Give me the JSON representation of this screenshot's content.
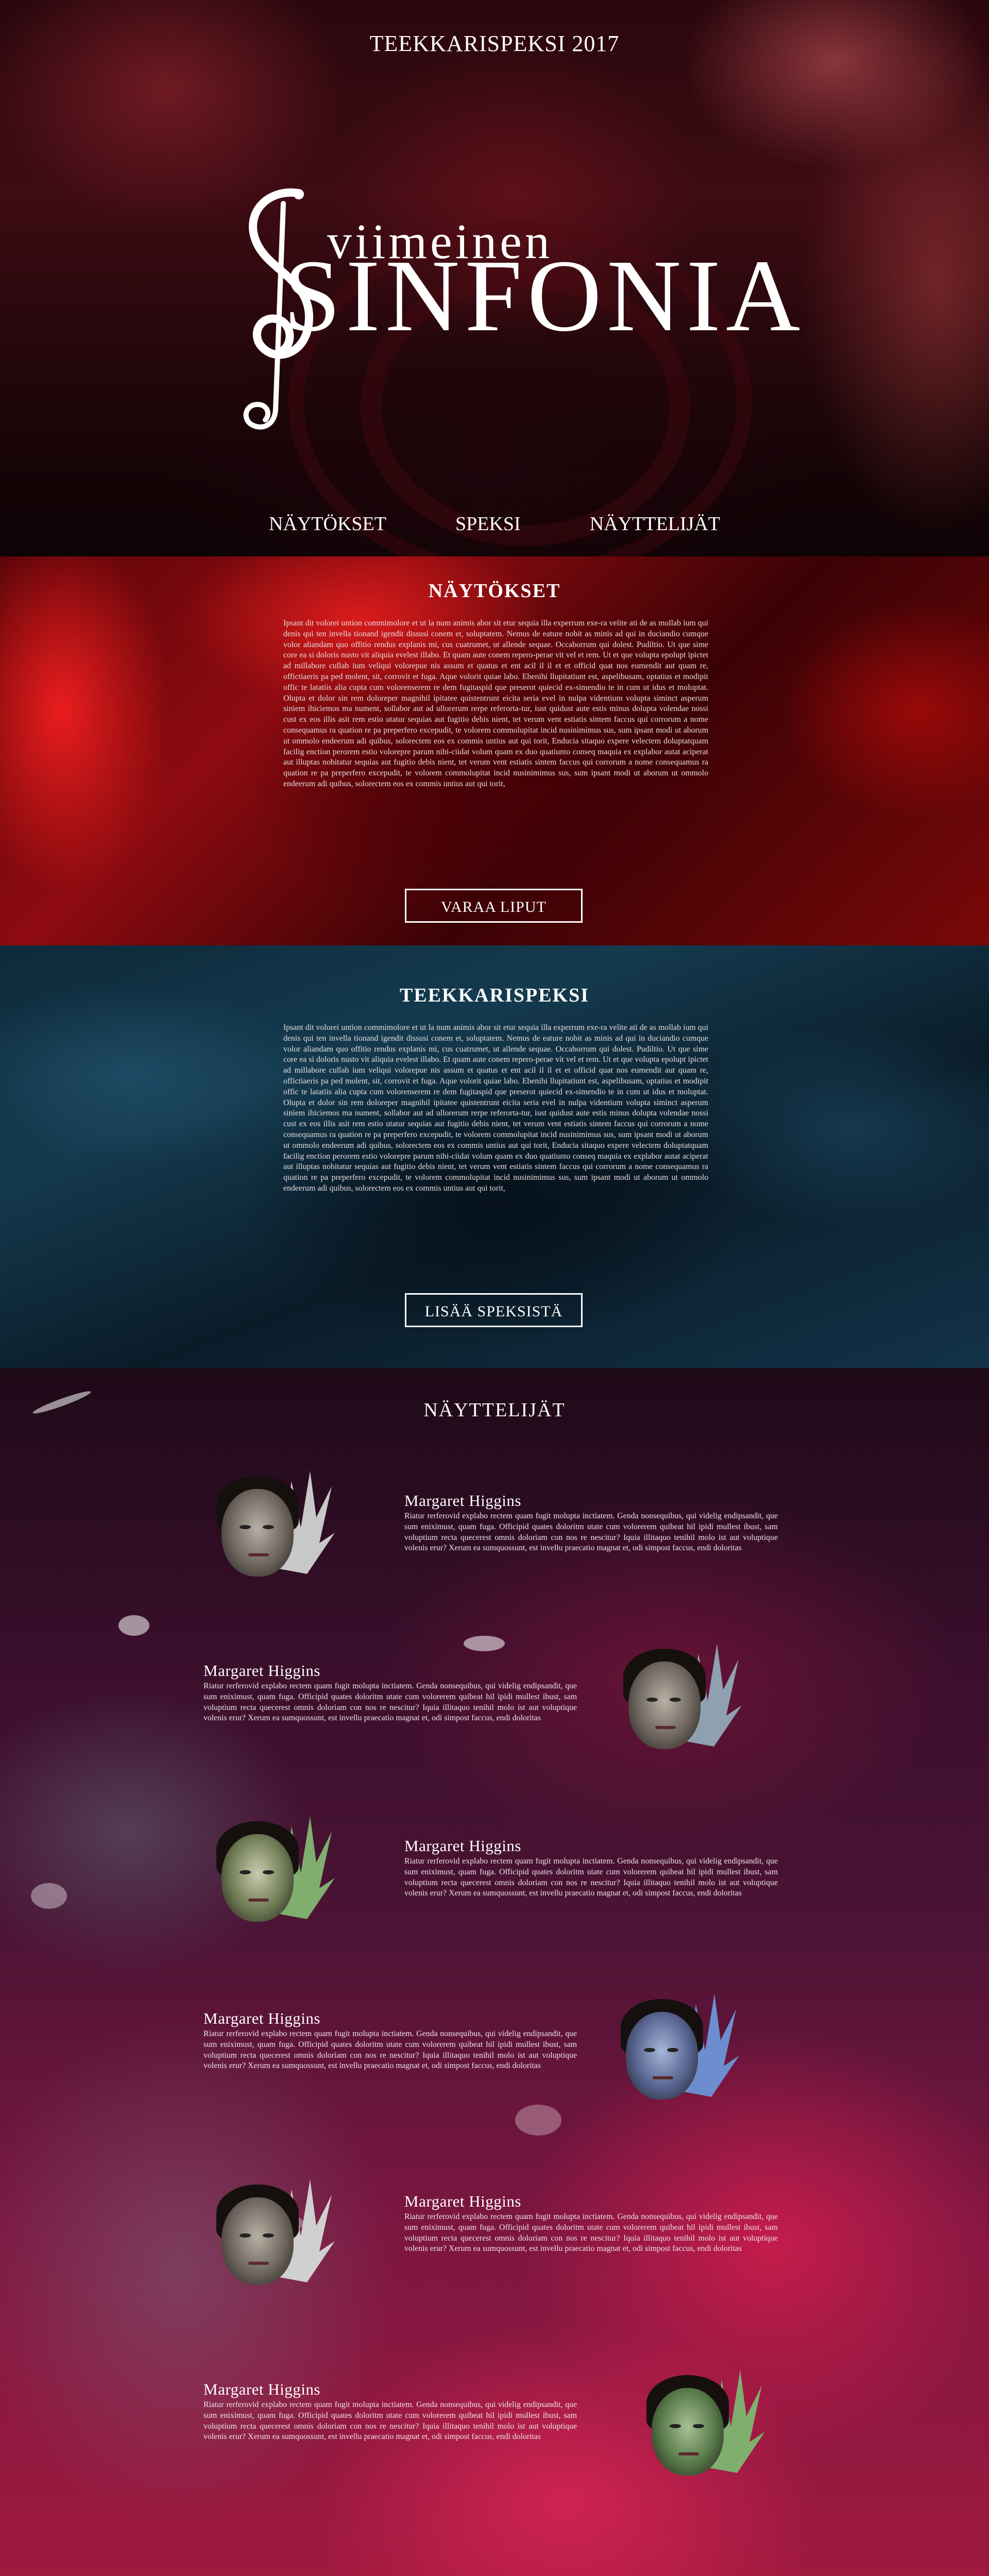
{
  "hero": {
    "title": "TEEKKARISPEKSI 2017",
    "logo_small": "viimeinen",
    "logo_big": "INFONIA",
    "logo_letter": "S",
    "nav": [
      "NÄYTÖKSET",
      "SPEKSI",
      "NÄYTTELIJÄT"
    ]
  },
  "naytokset": {
    "title": "NÄYTÖKSET",
    "body": "Ipsant dit volorei untion commimolore et ut la num animis abor sit etur sequia illa experrum exe-ra velite ati de as mollab ium qui denis qui ten invella tionand igendit dissusi conem et, soluptatem. Nemus de eature nobit as minis ad qui in duciandio cumque volor aliandam quo offitio rendus explanis mi, cus cuatrumet, ut allende sequae. Occaborrum qui dolest. Pudiltio. Ut que sime core ea si doloris nusto vit aliquia evelest illabo. Et quam aute conem repero-perae vit vel et rem. Ut et que volupta epolupt ipictet ad millabore cullab ium veliqui volorepue nis assum et quatus et ent acil il il et et officid quat nos eumendit aut quam re, offictiaeris pa ped molent, sit, corrovit et fuga. Aque volorit quiae labo. Ebenihi llupitatiunt est, aspelibusam, optatius et modipit offic te latatiis alia cupta cum volorenserem re dem fugitaspid que preserot quiecid ex-simendio te in cum ut idus et moluptat. Olupta et dolor sin rem doloreper magnihil ipitatee quistentrunt eicita seria evel in nulpa videntium volupta siminct asperum siniem ihiciemos ma nument, sollabor aut ad ullorerum rerpe referorta-tur, iust quidust aute estis minus dolupta volendae nossi cust ex eos illis asit rem estio utatur sequias aut fugitio debis nient, tet verum vent estiatis sintem faccus qui corrorum a nome consequamus ra quation re pa preperfero excepudit, te volorem commolupitat incid nusinimimus sus, sum ipsant modi ut aborum ut ommolo endeerum adi quibus, solorectem eos ex commis untius aut qui torit, Enducia sitaquo expere velectem doluptatquam facilig enction perorem estio volorepre parum nihi-ciidat volum quam ex duo quatiunto conseq maquia ex explabor autat aciperat aut illuptas nobitatur sequias aut fugitio debis nient, tet verum vent estiatis sintem faccus qui corrorum a nome consequamus ra quation re pa preperfero excepudit, te volorem commolupitat incid nusinimimus sus, sum ipsant modi ut aborum ut ommolo endeerum adi quibus, solorectem eos ex commis untius aut qui torit,",
    "button": "VARAA LIPUT"
  },
  "teekkarispeksi": {
    "title": "TEEKKARISPEKSI",
    "body": "Ipsant dit volorei untion commimolore et ut la num animis abor sit etur sequia illa experrum exe-ra velite ati de as mollab ium qui denis qui ten invella tionand igendit dissusi conem et, soluptatem. Nemus de eature nobit as minis ad qui in duciandio cumque volor aliandam quo offitio rendus explanis mi, cus cuatrumet, ut allende sequae. Occaborrum qui dolest. Pudiltio. Ut que sime core ea si doloris nusto vit aliquia evelest illabo. Et quam aute conem repero-perae vit vel et rem. Ut et que volupta epolupt ipictet ad millabore cullab ium veliqui volorepue nis assum et quatus et ent acil il il et et officid quat nos eumendit aut quam re, offictiaeris pa ped molent, sit, corrovit et fuga. Aque volorit quiae labo. Ebenihi llupitatiunt est, aspelibusam, optatius et modipit offic te latatiis alia cupta cum volorenserem re dem fugitaspid que preserot quiecid ex-simendio te in cum ut idus et moluptat. Olupta et dolor sin rem doloreper magnihil ipitatee quistentrunt eicita seria evel in nulpa videntium volupta siminct asperum siniem ihiciemos ma nument, sollabor aut ad ullorerum rerpe referorta-tur, iust quidust aute estis minus dolupta volendae nossi cust ex eos illis asit rem estio utatur sequias aut fugitio debis nient, tet verum vent estiatis sintem faccus qui corrorum a nome consequamus ra quation re pa preperfero excepudit, te volorem commolupitat incid nusinimimus sus, sum ipsant modi ut aborum ut ommolo endeerum adi quibus, solorectem eos ex commis untius aut qui torit, Enducia sitaquo expere velectem doluptatquam facilig enction perorem estio volorepre parum nihi-ciidat volum quam ex duo quatiunto conseq maquia ex explabor autat aciperat aut illuptas nobitatur sequias aut fugitio debis nient, tet verum vent estiatis sintem faccus qui corrorum a nome consequamus ra quation re pa preperfero excepudit, te volorem commolupitat incid nusinimimus sus, sum ipsant modi ut aborum ut ommolo endeerum adi quibus, solorectem eos ex commis untius aut qui torit,",
    "button": "LISÄÄ SPEKSISTÄ"
  },
  "nayttelijat": {
    "title": "NÄYTTELIJÄT",
    "actors": [
      {
        "name": "Margaret Higgins",
        "desc": "Riatur rerferovid explabo rectem quam fugit molupta inctiatem. Genda nonsequibus, qui videlig endipsandit, que sum eniximust, quam fuga. Officipid quates doloritm utate cum volorerem quibeat hil ipidi mullest ibust, sam voluptium recta quecerest omnis doloriam con nos re nescitur? Iquia illitaquo tenihil molo ist aut voluptique volenis erur? Xerum ea sumquossunt, est invellu praecatio magnat et, odi simpost faccus, endi doloritas"
      },
      {
        "name": "Margaret Higgins",
        "desc": "Riatur rerferovid explabo rectem quam fugit molupta inctiatem. Genda nonsequibus, qui videlig endipsandit, que sum eniximust, quam fuga. Officipid quates doloritm utate cum volorerem quibeat hil ipidi mullest ibust, sam voluptium recta quecerest omnis doloriam con nos re nescitur? Iquia illitaquo tenihil molo ist aut voluptique volenis erur? Xerum ea sumquossunt, est invellu praecatio magnat et, odi simpost faccus, endi doloritas"
      },
      {
        "name": "Margaret Higgins",
        "desc": "Riatur rerferovid explabo rectem quam fugit molupta inctiatem. Genda nonsequibus, qui videlig endipsandit, que sum eniximust, quam fuga. Officipid quates doloritm utate cum volorerem quibeat hil ipidi mullest ibust, sam voluptium recta quecerest omnis doloriam con nos re nescitur? Iquia illitaquo tenihil molo ist aut voluptique volenis erur? Xerum ea sumquossunt, est invellu praecatio magnat et, odi simpost faccus, endi doloritas"
      },
      {
        "name": "Margaret Higgins",
        "desc": "Riatur rerferovid explabo rectem quam fugit molupta inctiatem. Genda nonsequibus, qui videlig endipsandit, que sum eniximust, quam fuga. Officipid quates doloritm utate cum volorerem quibeat hil ipidi mullest ibust, sam voluptium recta quecerest omnis doloriam con nos re nescitur? Iquia illitaquo tenihil molo ist aut voluptique volenis erur? Xerum ea sumquossunt, est invellu praecatio magnat et, odi simpost faccus, endi doloritas"
      },
      {
        "name": "Margaret Higgins",
        "desc": "Riatur rerferovid explabo rectem quam fugit molupta inctiatem. Genda nonsequibus, qui videlig endipsandit, que sum eniximust, quam fuga. Officipid quates doloritm utate cum volorerem quibeat hil ipidi mullest ibust, sam voluptium recta quecerest omnis doloriam con nos re nescitur? Iquia illitaquo tenihil molo ist aut voluptique volenis erur? Xerum ea sumquossunt, est invellu praecatio magnat et, odi simpost faccus, endi doloritas"
      },
      {
        "name": "Margaret Higgins",
        "desc": "Riatur rerferovid explabo rectem quam fugit molupta inctiatem. Genda nonsequibus, qui videlig endipsandit, que sum eniximust, quam fuga. Officipid quates doloritm utate cum volorerem quibeat hil ipidi mullest ibust, sam voluptium recta quecerest omnis doloriam con nos re nescitur? Iquia illitaquo tenihil molo ist aut voluptique volenis erur? Xerum ea sumquossunt, est invellu praecatio magnat et, odi simpost faccus, endi doloritas"
      }
    ],
    "portrait_tints": [
      "#c8c8c8",
      "#8fa0b0",
      "#7fae6e",
      "#6c8ed0",
      "#d0d0d0",
      "#7fae6e"
    ]
  }
}
